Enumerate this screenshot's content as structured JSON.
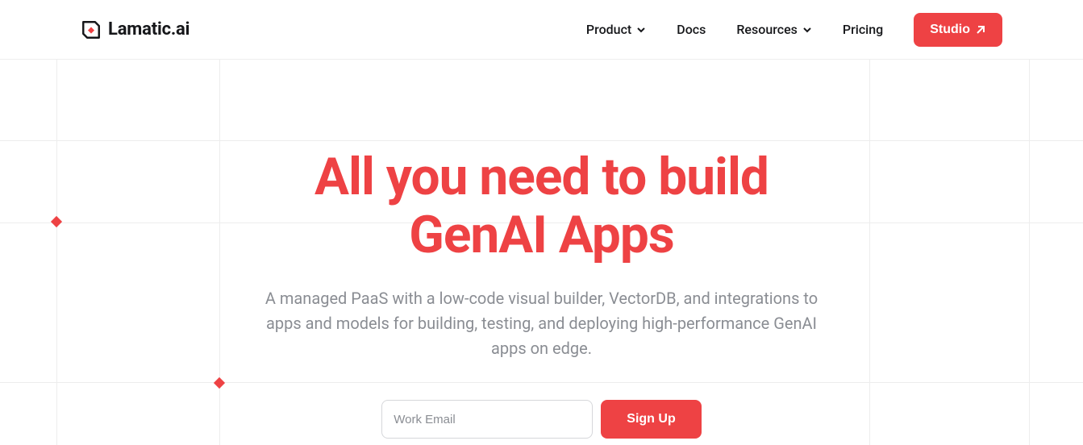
{
  "brand": {
    "name": "Lamatic.ai",
    "accent": "#ee4244"
  },
  "nav": {
    "items": [
      {
        "label": "Product",
        "has_menu": true
      },
      {
        "label": "Docs",
        "has_menu": false
      },
      {
        "label": "Resources",
        "has_menu": true
      },
      {
        "label": "Pricing",
        "has_menu": false
      }
    ],
    "cta_label": "Studio"
  },
  "hero": {
    "headline_line1": "All you need to build",
    "headline_line2": "GenAI Apps",
    "subhead": "A managed PaaS with a low-code visual builder, VectorDB, and integrations to apps and models for building, testing, and deploying high-performance GenAI apps on edge."
  },
  "signup": {
    "email_placeholder": "Work Email",
    "button_label": "Sign Up"
  }
}
